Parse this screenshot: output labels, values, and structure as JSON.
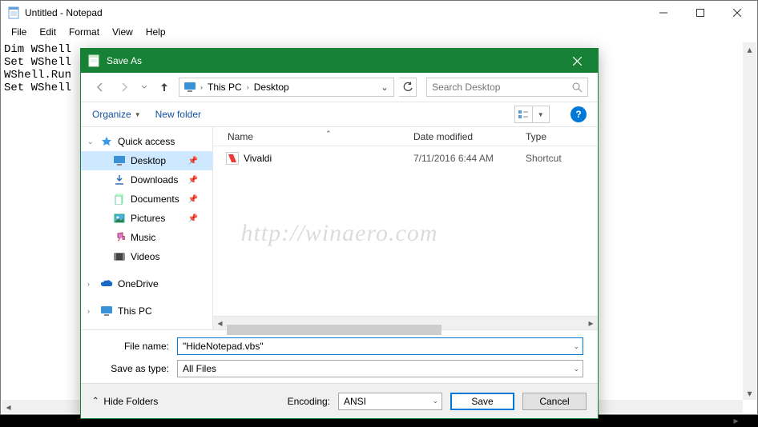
{
  "notepad": {
    "title": "Untitled - Notepad",
    "menu": {
      "file": "File",
      "edit": "Edit",
      "format": "Format",
      "view": "View",
      "help": "Help"
    },
    "content": "Dim WShell\nSet WShell\nWShell.Run\nSet WShell"
  },
  "saveas": {
    "title": "Save As",
    "breadcrumb": {
      "root_chev": "«",
      "this_pc": "This PC",
      "folder": "Desktop"
    },
    "search_placeholder": "Search Desktop",
    "toolbar": {
      "organize": "Organize",
      "new_folder": "New folder"
    },
    "sidebar": {
      "quick_access": "Quick access",
      "items": [
        {
          "label": "Desktop",
          "pinned": true,
          "selected": true,
          "icon": "desktop"
        },
        {
          "label": "Downloads",
          "pinned": true,
          "icon": "downloads"
        },
        {
          "label": "Documents",
          "pinned": true,
          "icon": "documents"
        },
        {
          "label": "Pictures",
          "pinned": true,
          "icon": "pictures"
        },
        {
          "label": "Music",
          "pinned": false,
          "icon": "music"
        },
        {
          "label": "Videos",
          "pinned": false,
          "icon": "videos"
        }
      ],
      "onedrive": "OneDrive",
      "this_pc": "This PC"
    },
    "columns": {
      "name": "Name",
      "date": "Date modified",
      "type": "Type"
    },
    "files": [
      {
        "name": "Vivaldi",
        "date": "7/11/2016 6:44 AM",
        "type": "Shortcut"
      }
    ],
    "form": {
      "filename_label": "File name:",
      "filename_value": "\"HideNotepad.vbs\"",
      "savetype_label": "Save as type:",
      "savetype_value": "All Files"
    },
    "footer": {
      "hide_folders": "Hide Folders",
      "encoding_label": "Encoding:",
      "encoding_value": "ANSI",
      "save": "Save",
      "cancel": "Cancel"
    }
  },
  "watermark": "http://winaero.com"
}
